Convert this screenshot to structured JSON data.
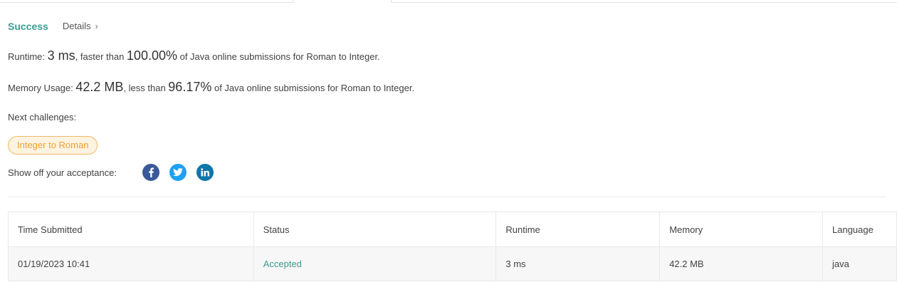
{
  "result": {
    "status": "Success",
    "details_label": "Details",
    "runtime": {
      "label": "Runtime: ",
      "value": "3 ms",
      "comparison": ", faster than ",
      "percent": "100.00%",
      "suffix": " of Java online submissions for Roman to Integer."
    },
    "memory": {
      "label": "Memory Usage: ",
      "value": "42.2 MB",
      "comparison": ", less than ",
      "percent": "96.17%",
      "suffix": " of Java online submissions for Roman to Integer."
    },
    "next_label": "Next challenges:",
    "next_challenge": "Integer to Roman",
    "share_label": "Show off your acceptance:",
    "share_icons": [
      "facebook-icon",
      "twitter-icon",
      "linkedin-icon"
    ]
  },
  "table": {
    "headers": [
      "Time Submitted",
      "Status",
      "Runtime",
      "Memory",
      "Language"
    ],
    "rows": [
      [
        "01/19/2023 10:41",
        "Accepted",
        "3 ms",
        "42.2 MB",
        "java"
      ]
    ]
  },
  "colors": {
    "success": "#3a9c8f",
    "challenge_pill": "#f0a030",
    "facebook": "#3b5998",
    "twitter": "#1da1f2",
    "linkedin": "#0e76a8"
  }
}
